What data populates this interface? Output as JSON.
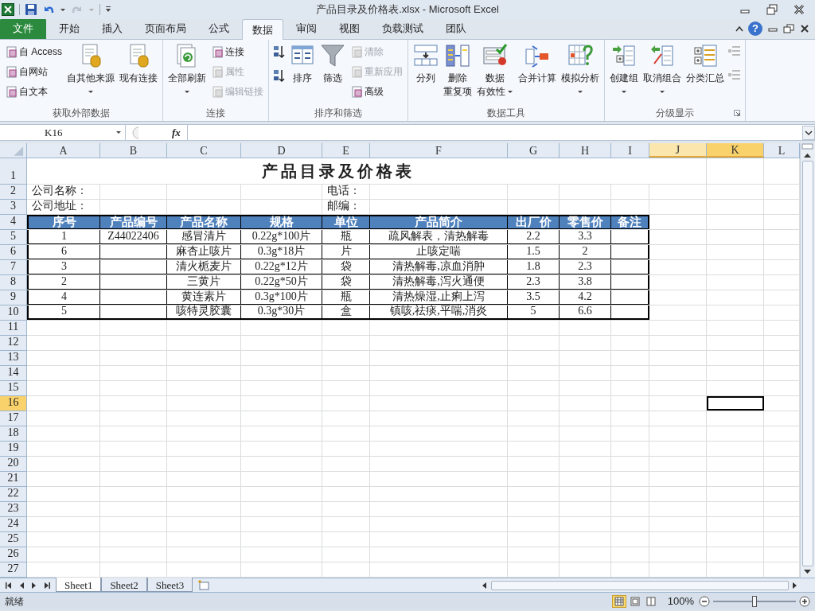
{
  "window": {
    "title": "产品目录及价格表.xlsx - Microsoft Excel"
  },
  "ribbon_tabs": [
    {
      "label": "文件",
      "kind": "file",
      "selected": false
    },
    {
      "label": "开始",
      "kind": "tab",
      "selected": false
    },
    {
      "label": "插入",
      "kind": "tab",
      "selected": false
    },
    {
      "label": "页面布局",
      "kind": "tab",
      "selected": false
    },
    {
      "label": "公式",
      "kind": "tab",
      "selected": false
    },
    {
      "label": "数据",
      "kind": "tab",
      "selected": true
    },
    {
      "label": "审阅",
      "kind": "tab",
      "selected": false
    },
    {
      "label": "视图",
      "kind": "tab",
      "selected": false
    },
    {
      "label": "负载测试",
      "kind": "tab",
      "selected": false
    },
    {
      "label": "团队",
      "kind": "tab",
      "selected": false
    }
  ],
  "help_button": "?",
  "ribbon_groups": [
    {
      "label": "获取外部数据",
      "launcher": false,
      "items": [
        {
          "kind": "stack",
          "buttons": [
            {
              "label": "自 Access",
              "disabled": false
            },
            {
              "label": "自网站",
              "disabled": false
            },
            {
              "label": "自文本",
              "disabled": false
            }
          ]
        },
        {
          "kind": "large",
          "lines": [
            "自其他来源"
          ],
          "dropdown": true,
          "disabled": false
        },
        {
          "kind": "large",
          "lines": [
            "现有连接"
          ],
          "dropdown": false,
          "disabled": false
        }
      ]
    },
    {
      "label": "连接",
      "launcher": false,
      "items": [
        {
          "kind": "large",
          "lines": [
            "全部刷新"
          ],
          "dropdown": true,
          "disabled": false
        },
        {
          "kind": "stack",
          "buttons": [
            {
              "label": "连接",
              "disabled": false
            },
            {
              "label": "属性",
              "disabled": true
            },
            {
              "label": "编辑链接",
              "disabled": true
            }
          ]
        }
      ]
    },
    {
      "label": "排序和筛选",
      "launcher": false,
      "items": [
        {
          "kind": "icons",
          "count_buttons": [
            {
              "disabled": false
            },
            {
              "disabled": false
            }
          ]
        },
        {
          "kind": "large",
          "lines": [
            "排序"
          ],
          "dropdown": false,
          "disabled": false
        },
        {
          "kind": "large",
          "lines": [
            "筛选"
          ],
          "dropdown": false,
          "disabled": false
        },
        {
          "kind": "stack",
          "buttons": [
            {
              "label": "清除",
              "disabled": true
            },
            {
              "label": "重新应用",
              "disabled": true
            },
            {
              "label": "高级",
              "disabled": false
            }
          ]
        }
      ]
    },
    {
      "label": "数据工具",
      "launcher": false,
      "items": [
        {
          "kind": "large",
          "lines": [
            "分列"
          ],
          "dropdown": false,
          "disabled": false
        },
        {
          "kind": "large",
          "lines": [
            "删除",
            "重复项"
          ],
          "dropdown": false,
          "disabled": false
        },
        {
          "kind": "large",
          "lines": [
            "数据",
            "有效性"
          ],
          "dropdown": true,
          "disabled": false
        },
        {
          "kind": "large",
          "lines": [
            "合并计算"
          ],
          "dropdown": false,
          "disabled": false
        },
        {
          "kind": "large",
          "lines": [
            "模拟分析"
          ],
          "dropdown": true,
          "disabled": false
        }
      ]
    },
    {
      "label": "分级显示",
      "launcher": true,
      "items": [
        {
          "kind": "large",
          "lines": [
            "创建组"
          ],
          "dropdown": true,
          "disabled": false
        },
        {
          "kind": "large",
          "lines": [
            "取消组合"
          ],
          "dropdown": true,
          "disabled": false
        },
        {
          "kind": "large",
          "lines": [
            "分类汇总"
          ],
          "dropdown": false,
          "disabled": false
        },
        {
          "kind": "icons",
          "count_buttons": [
            {
              "disabled": true
            },
            {
              "disabled": true
            }
          ]
        }
      ]
    }
  ],
  "formula_bar": {
    "name_box": "K16",
    "fx_label": "fx"
  },
  "sheet": {
    "columns": [
      {
        "label": "A",
        "selected": false,
        "active": false
      },
      {
        "label": "B",
        "selected": false,
        "active": false
      },
      {
        "label": "C",
        "selected": false,
        "active": false
      },
      {
        "label": "D",
        "selected": false,
        "active": false
      },
      {
        "label": "E",
        "selected": false,
        "active": false
      },
      {
        "label": "F",
        "selected": false,
        "active": false
      },
      {
        "label": "G",
        "selected": false,
        "active": false
      },
      {
        "label": "H",
        "selected": false,
        "active": false
      },
      {
        "label": "I",
        "selected": false,
        "active": false
      },
      {
        "label": "J",
        "selected": true,
        "active": false
      },
      {
        "label": "K",
        "selected": true,
        "active": true
      },
      {
        "label": "L",
        "selected": false,
        "active": false
      }
    ],
    "row_headers": [
      {
        "label": "1",
        "selected": false
      },
      {
        "label": "2",
        "selected": false
      },
      {
        "label": "3",
        "selected": false
      },
      {
        "label": "4",
        "selected": false
      },
      {
        "label": "5",
        "selected": false
      },
      {
        "label": "6",
        "selected": false
      },
      {
        "label": "7",
        "selected": false
      },
      {
        "label": "8",
        "selected": false
      },
      {
        "label": "9",
        "selected": false
      },
      {
        "label": "10",
        "selected": false
      },
      {
        "label": "11",
        "selected": false
      },
      {
        "label": "12",
        "selected": false
      },
      {
        "label": "13",
        "selected": false
      },
      {
        "label": "14",
        "selected": false
      },
      {
        "label": "15",
        "selected": false
      },
      {
        "label": "16",
        "selected": true
      },
      {
        "label": "17",
        "selected": false
      },
      {
        "label": "18",
        "selected": false
      },
      {
        "label": "19",
        "selected": false
      },
      {
        "label": "20",
        "selected": false
      },
      {
        "label": "21",
        "selected": false
      },
      {
        "label": "22",
        "selected": false
      },
      {
        "label": "23",
        "selected": false
      },
      {
        "label": "24",
        "selected": false
      },
      {
        "label": "25",
        "selected": false
      },
      {
        "label": "26",
        "selected": false
      },
      {
        "label": "27",
        "selected": false
      }
    ],
    "title": "产品目录及价格表",
    "info_rows": [
      {
        "left": "公司名称：",
        "right": "电话："
      },
      {
        "left": "公司地址：",
        "right": "邮编："
      }
    ],
    "table_headers": [
      "序号",
      "产品编号",
      "产品名称",
      "规格",
      "单位",
      "产品简介",
      "出厂价",
      "零售价",
      "备注"
    ],
    "table_rows": [
      {
        "no": "1",
        "code": "Z44022406",
        "name": "感冒清片",
        "spec": "0.22g*100片",
        "unit": "瓶",
        "intro": "疏风解表，清热解毒",
        "factory_price": "2.2",
        "retail_price": "3.3"
      },
      {
        "no": "6",
        "name": "麻杏止咳片",
        "spec": "0.3g*18片",
        "unit": "片",
        "intro": "止咳定喘",
        "factory_price": "1.5",
        "retail_price": "2"
      },
      {
        "no": "3",
        "name": "清火栀麦片",
        "spec": "0.22g*12片",
        "unit": "袋",
        "intro": "清热解毒,凉血消肿",
        "factory_price": "1.8",
        "retail_price": "2.3"
      },
      {
        "no": "2",
        "name": "三黄片",
        "spec": "0.22g*50片",
        "unit": "袋",
        "intro": "清热解毒,泻火通便",
        "factory_price": "2.3",
        "retail_price": "3.8"
      },
      {
        "no": "4",
        "name": "黄连素片",
        "spec": "0.3g*100片",
        "unit": "瓶",
        "intro": "清热燥湿,止痢上泻",
        "factory_price": "3.5",
        "retail_price": "4.2"
      },
      {
        "no": "5",
        "name": "咳特灵胶囊",
        "spec": "0.3g*30片",
        "unit": "盒",
        "intro": "镇咳,祛痰,平喘,消炎",
        "factory_price": "5",
        "retail_price": "6.6"
      }
    ]
  },
  "sheet_tabs": [
    {
      "label": "Sheet1",
      "selected": true
    },
    {
      "label": "Sheet2",
      "selected": false
    },
    {
      "label": "Sheet3",
      "selected": false
    }
  ],
  "status_bar": {
    "text": "就绪",
    "zoom": "100%",
    "views": [
      {
        "selected": true
      },
      {
        "selected": false
      },
      {
        "selected": false
      }
    ],
    "zoom_slider": {
      "level": 0.5
    }
  }
}
